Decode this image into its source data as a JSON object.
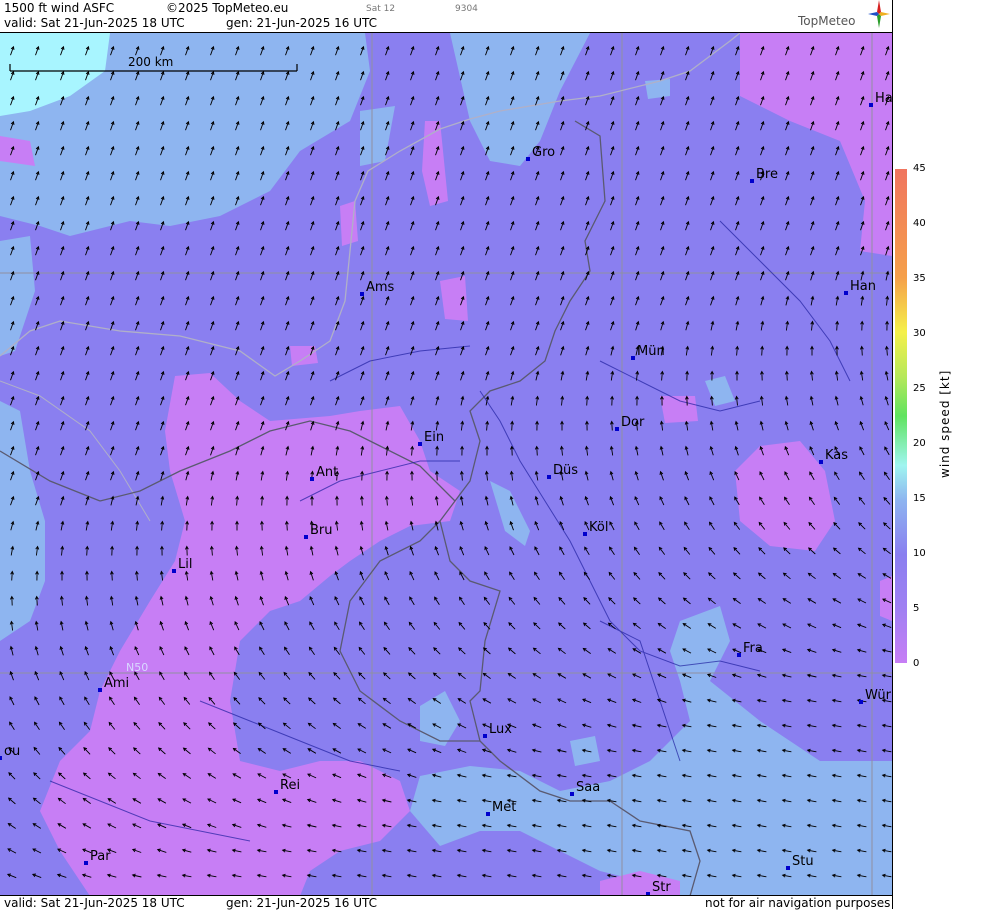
{
  "header": {
    "product": "1500 ft wind ASFC",
    "copyright": "©2025 TopMeteo.eu",
    "run_small": "Sat 12",
    "code_small": "9304",
    "valid": "valid:  Sat  21-Jun-2025  18 UTC",
    "gen": "gen: 21-Jun-2025 16 UTC",
    "logo": "TopMeteo"
  },
  "footer": {
    "valid": "valid:  Sat  21-Jun-2025  18 UTC",
    "gen": "gen: 21-Jun-2025 16 UTC",
    "disclaimer": "not for air navigation purposes"
  },
  "scalebar": {
    "label": "200 km"
  },
  "grid_label": "N50",
  "cities": [
    {
      "name": "Ha"
    },
    {
      "name": "Gro"
    },
    {
      "name": "Bre"
    },
    {
      "name": "Ams"
    },
    {
      "name": "Han"
    },
    {
      "name": "Mün"
    },
    {
      "name": "Dor"
    },
    {
      "name": "Ein"
    },
    {
      "name": "Kas"
    },
    {
      "name": "Ant"
    },
    {
      "name": "Düs"
    },
    {
      "name": "Köl"
    },
    {
      "name": "Bru"
    },
    {
      "name": "Lil"
    },
    {
      "name": "Fra"
    },
    {
      "name": "Ami"
    },
    {
      "name": "Wür"
    },
    {
      "name": "Lux"
    },
    {
      "name": "Rei"
    },
    {
      "name": "Saa"
    },
    {
      "name": "ou"
    },
    {
      "name": "Met"
    },
    {
      "name": "Par"
    },
    {
      "name": "Stu"
    },
    {
      "name": "Str"
    }
  ],
  "legend": {
    "title": "wind  speed  [kt]",
    "ticks": [
      "45",
      "40",
      "35",
      "30",
      "25",
      "20",
      "15",
      "10",
      "5",
      "0"
    ],
    "colors": [
      "#c77ef5",
      "#8a7ff0",
      "#8eb5f0",
      "#9ff5f0",
      "#5fe35f",
      "#f5f04a",
      "#f5a04a",
      "#f0755f"
    ]
  },
  "colors": {
    "violet": "#8a7ff0",
    "purple": "#c77ef5",
    "lightblue": "#8eb5f0",
    "cyan": "#a8f5ff"
  }
}
